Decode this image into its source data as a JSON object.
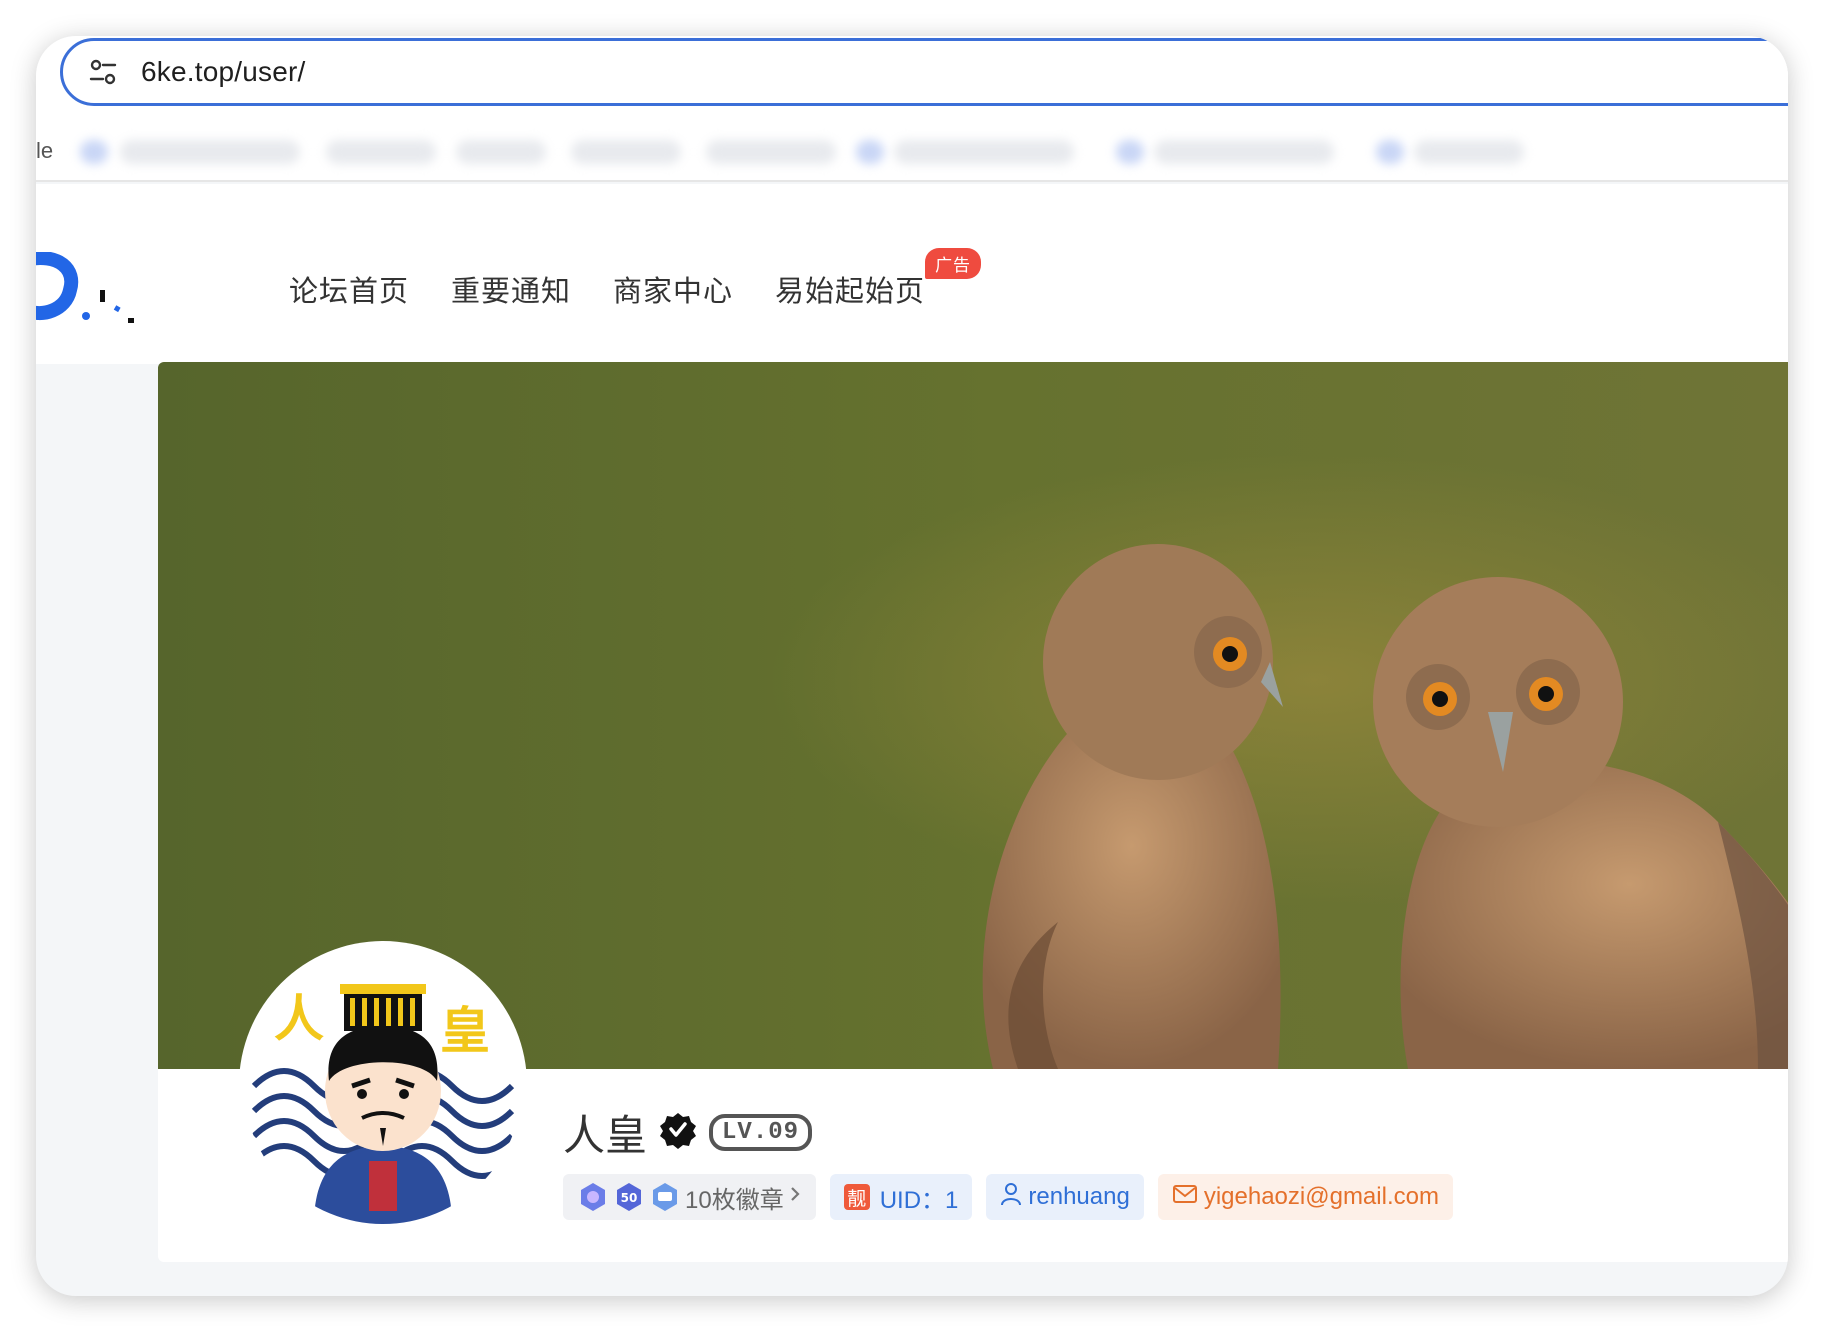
{
  "browser": {
    "url": "6ke.top/user/",
    "bookmarks_edge_text": "le"
  },
  "header": {
    "nav": [
      {
        "label": "论坛首页"
      },
      {
        "label": "重要通知"
      },
      {
        "label": "商家中心"
      },
      {
        "label": "易始起始页",
        "badge": "广告"
      }
    ]
  },
  "profile": {
    "name": "人皇",
    "level": "LV.09",
    "avatar_text_left": "人",
    "avatar_text_right": "皇",
    "badge_summary": "10枚徽章",
    "badge_medal_text": "50",
    "uid_tag": "靓",
    "uid": "UID：1",
    "username": "renhuang",
    "email": "yigehaozi@gmail.com"
  },
  "icons": {
    "address": "tune-icon",
    "verified": "verified-check-icon",
    "user": "user-icon",
    "mail": "mail-icon",
    "chevron": "chevron-right-icon"
  },
  "colors": {
    "accent_blue": "#2f6fd6",
    "address_border": "#3b6fd8",
    "ad_red": "#ef4b3f",
    "email_orange": "#e4702b"
  }
}
